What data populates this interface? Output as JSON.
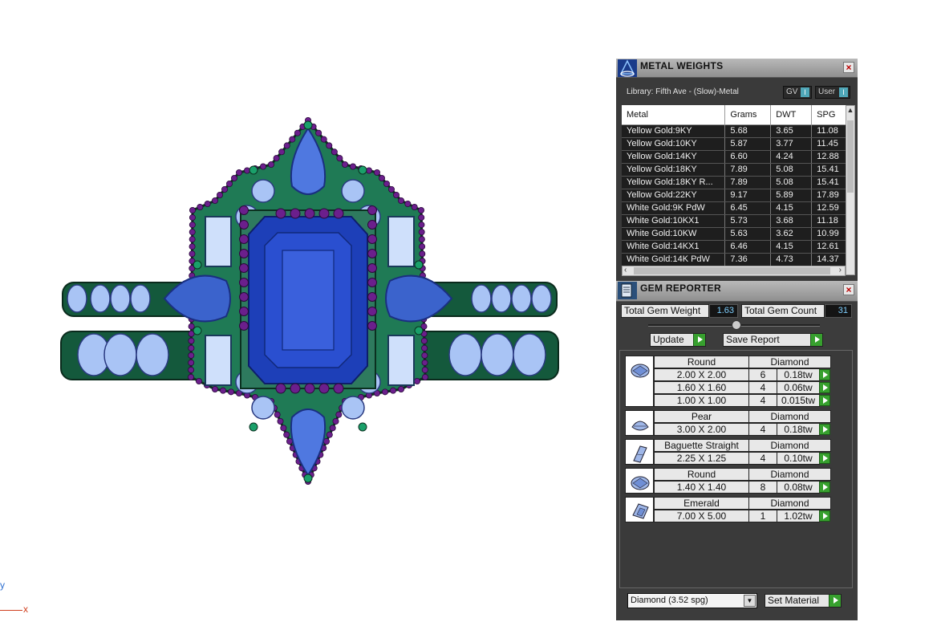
{
  "viewport": {
    "axis_y": "y",
    "axis_x": "x"
  },
  "metal_panel": {
    "title": "METAL WEIGHTS",
    "library": "Library: Fifth Ave - (Slow)-Metal",
    "toggle_gv": "GV",
    "toggle_user": "User",
    "toggle_knob": "I",
    "close": "×",
    "columns": [
      "Metal",
      "Grams",
      "DWT",
      "SPG"
    ],
    "rows": [
      [
        "Yellow Gold:9KY",
        "5.68",
        "3.65",
        "11.08"
      ],
      [
        "Yellow Gold:10KY",
        "5.87",
        "3.77",
        "11.45"
      ],
      [
        "Yellow Gold:14KY",
        "6.60",
        "4.24",
        "12.88"
      ],
      [
        "Yellow Gold:18KY",
        "7.89",
        "5.08",
        "15.41"
      ],
      [
        "Yellow Gold:18KY R...",
        "7.89",
        "5.08",
        "15.41"
      ],
      [
        "Yellow Gold:22KY",
        "9.17",
        "5.89",
        "17.89"
      ],
      [
        "White Gold:9K PdW",
        "6.45",
        "4.15",
        "12.59"
      ],
      [
        "White Gold:10KX1",
        "5.73",
        "3.68",
        "11.18"
      ],
      [
        "White Gold:10KW",
        "5.63",
        "3.62",
        "10.99"
      ],
      [
        "White Gold:14KX1",
        "6.46",
        "4.15",
        "12.61"
      ],
      [
        "White Gold:14K PdW",
        "7.36",
        "4.73",
        "14.37"
      ]
    ]
  },
  "gem_panel": {
    "title": "GEM REPORTER",
    "close": "×",
    "total_weight_label": "Total Gem Weight",
    "total_weight_value": "1.63",
    "total_count_label": "Total Gem Count",
    "total_count_value": "31",
    "update_label": "Update",
    "save_report_label": "Save Report",
    "material_value": "Diamond     (3.52 spg)",
    "set_material_label": "Set Material",
    "groups": [
      {
        "shape": "Round",
        "material": "Diamond",
        "icon": "round-gem-icon",
        "rows": [
          [
            "2.00 X 2.00",
            "6",
            "0.18tw"
          ],
          [
            "1.60 X 1.60",
            "4",
            "0.06tw"
          ],
          [
            "1.00 X 1.00",
            "4",
            "0.015tw"
          ]
        ]
      },
      {
        "shape": "Pear",
        "material": "Diamond",
        "icon": "pear-gem-icon",
        "rows": [
          [
            "3.00 X 2.00",
            "4",
            "0.18tw"
          ]
        ]
      },
      {
        "shape": "Baguette Straight",
        "material": "Diamond",
        "icon": "baguette-gem-icon",
        "rows": [
          [
            "2.25 X 1.25",
            "4",
            "0.10tw"
          ]
        ]
      },
      {
        "shape": "Round",
        "material": "Diamond",
        "icon": "round-gem-icon",
        "rows": [
          [
            "1.40 X 1.40",
            "8",
            "0.08tw"
          ]
        ]
      },
      {
        "shape": "Emerald",
        "material": "Diamond",
        "icon": "emerald-gem-icon",
        "rows": [
          [
            "7.00 X 5.00",
            "1",
            "1.02tw"
          ]
        ]
      }
    ]
  },
  "colors": {
    "metal_green": "#1f8a5a",
    "bead_purple": "#6b1f8c",
    "sapphire": "#2a4fd0",
    "diamond_blue": "#a9c4f5",
    "go_green": "#37a02e"
  }
}
